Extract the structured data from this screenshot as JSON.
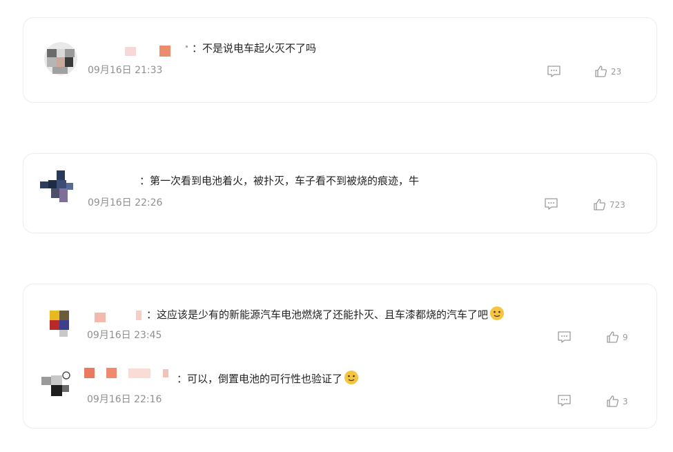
{
  "comments": [
    {
      "text": "：不是说电车起火灭不了吗",
      "time": "09月16日 21:33",
      "likes": "23"
    },
    {
      "text": "：第一次看到电池着火，被扑灭，车子看不到被烧的痕迹，牛",
      "time": "09月16日 22:26",
      "likes": "723"
    },
    {
      "text": "：这应该是少有的新能源汽车电池燃烧了还能扑灭、且车漆都烧的汽车了吧",
      "time": "09月16日 23:45",
      "likes": "9",
      "emoji": "doge-emoji"
    },
    {
      "text": "：可以，倒置电池的可行性也验证了",
      "time": "09月16日 22:16",
      "likes": "3",
      "emoji": "doge-emoji"
    }
  ],
  "icons": {
    "reply": "comment-bubble-icon",
    "like": "thumbs-up-icon"
  },
  "colors": {
    "text": "#222222",
    "meta": "#8f8f8f",
    "icon": "#9a9a9a",
    "emoji": "#f5c542"
  }
}
